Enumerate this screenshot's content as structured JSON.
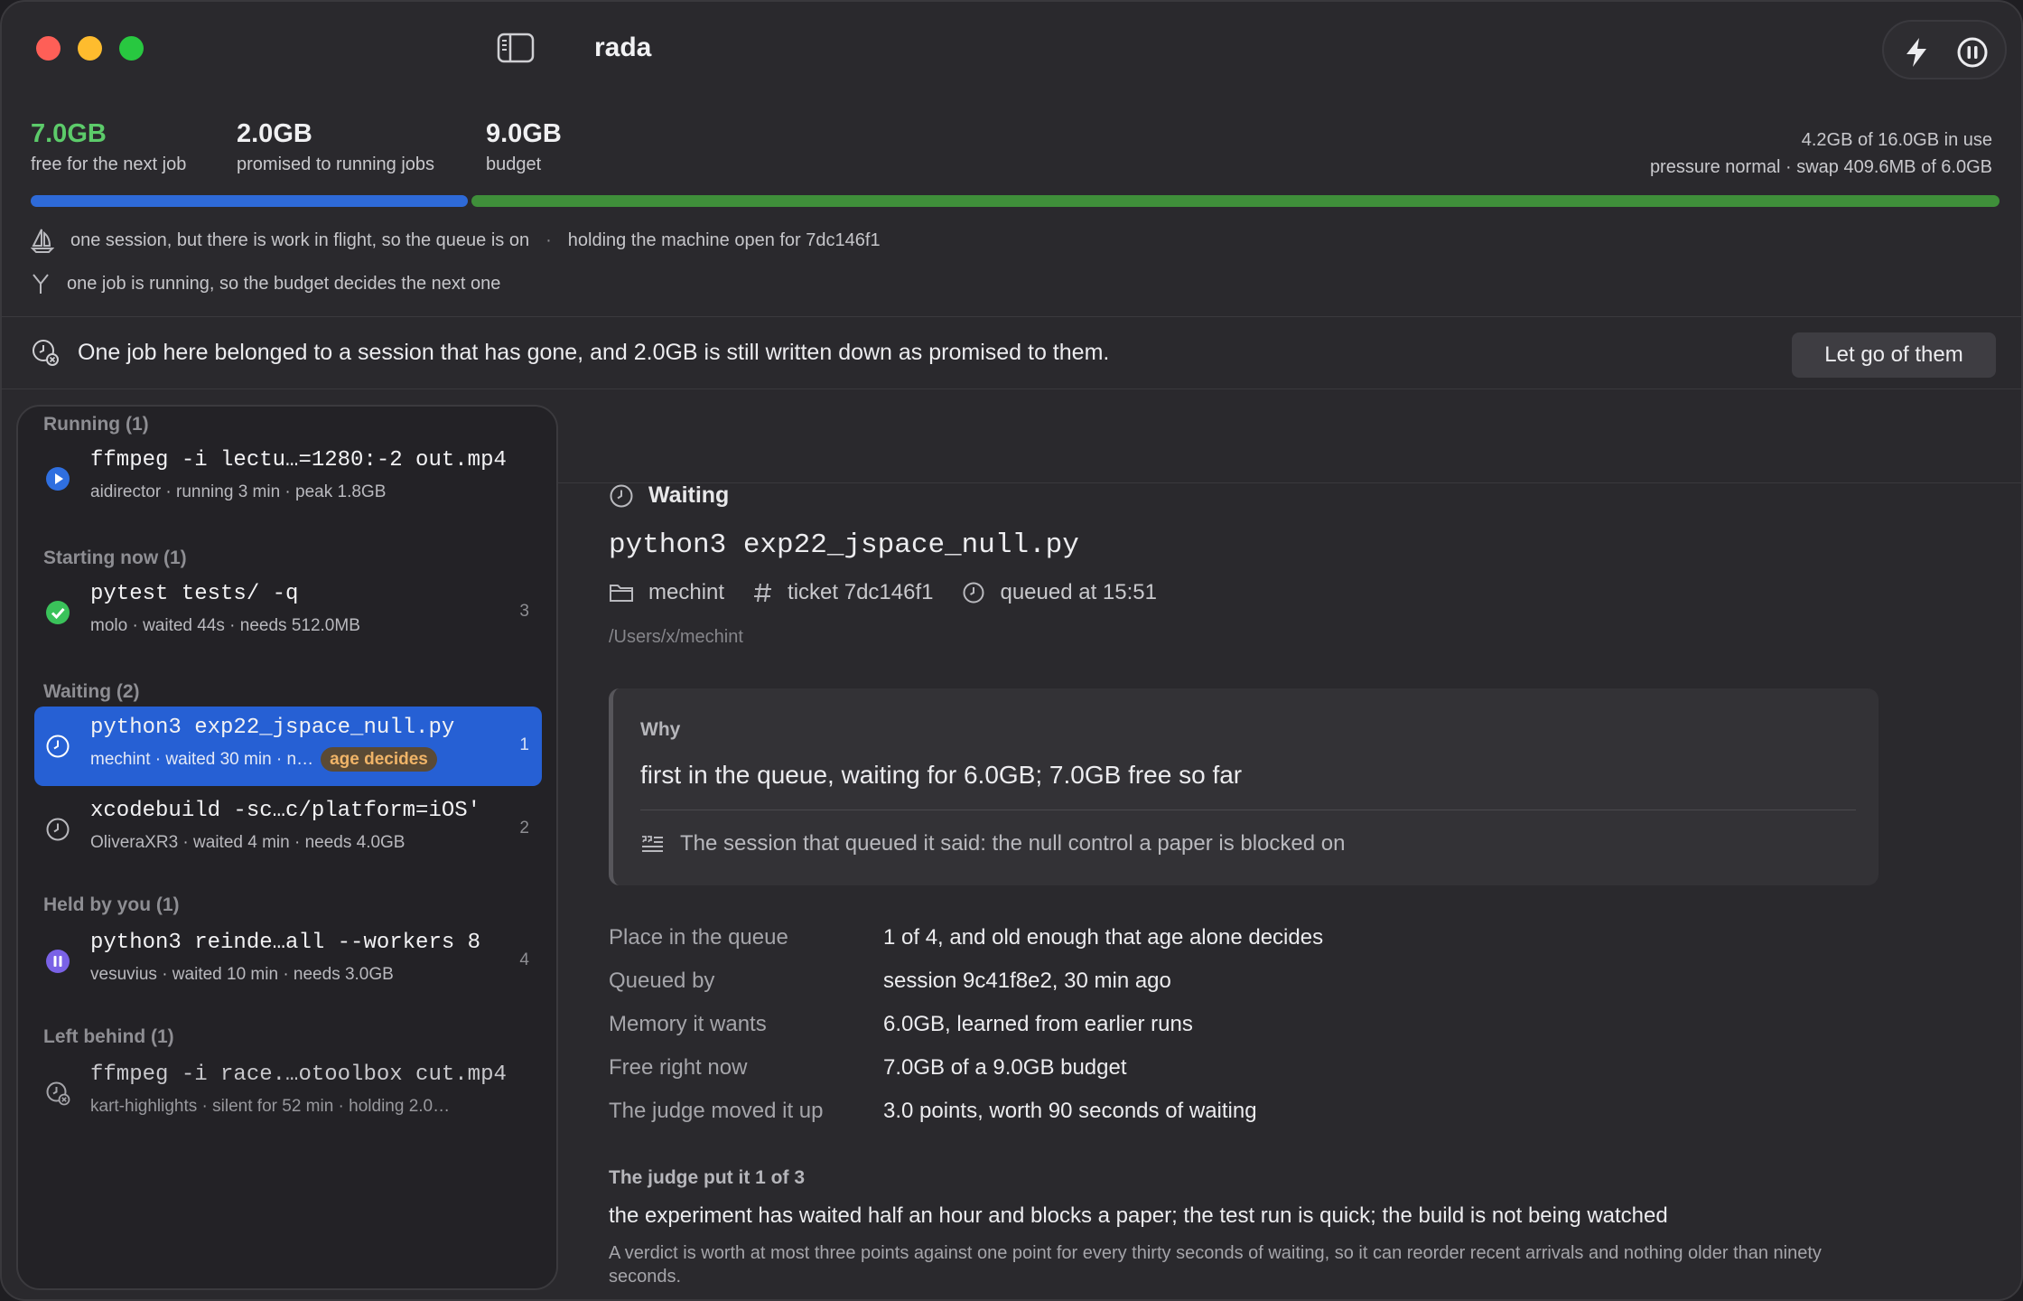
{
  "app": {
    "title": "rada"
  },
  "colors": {
    "accent_blue": "#2660d4",
    "free_green": "#5ccb6a",
    "bar_green": "#3f8f3a",
    "badge_orange": "#f0b468"
  },
  "toolbar": {
    "bolt_icon": "bolt-icon",
    "pause_icon": "pause-icon"
  },
  "stats": {
    "free": {
      "value": "7.0GB",
      "label": "free for the next job"
    },
    "promised": {
      "value": "2.0GB",
      "label": "promised to running jobs"
    },
    "budget": {
      "value": "9.0GB",
      "label": "budget"
    },
    "usage_line1": "4.2GB of 16.0GB in use",
    "usage_line2": "pressure normal · swap 409.6MB of 6.0GB"
  },
  "info": {
    "line1_a": "one session, but there is work in flight, so the queue is on",
    "line1_sep": "·",
    "line1_b": "holding the machine open for 7dc146f1",
    "line2": "one job is running, so the budget decides the next one"
  },
  "notice": {
    "text": "One job here belonged to a session that has gone, and 2.0GB is still written down as promised to them.",
    "button": "Let go of them"
  },
  "list": {
    "groups": [
      {
        "header": "Running (1)"
      },
      {
        "header": "Starting now (1)"
      },
      {
        "header": "Waiting (2)"
      },
      {
        "header": "Held by you (1)"
      },
      {
        "header": "Left behind (1)"
      }
    ],
    "items": [
      {
        "cmd": "ffmpeg -i lectu…=1280:-2 out.mp4",
        "meta": "aidirector  ·  running 3 min  ·  peak 1.8GB",
        "num": ""
      },
      {
        "cmd": "pytest tests/ -q",
        "meta": "molo  ·  waited 44s  ·  needs 512.0MB",
        "num": "3"
      },
      {
        "cmd": "python3 exp22_jspace_null.py",
        "meta": "mechint  ·  waited 30 min  ·  n…",
        "badge": "age decides",
        "num": "1"
      },
      {
        "cmd": "xcodebuild -sc…c/platform=iOS'",
        "meta": "OliveraXR3  ·  waited 4 min  ·  needs 4.0GB",
        "num": "2"
      },
      {
        "cmd": "python3 reinde…all --workers 8",
        "meta": "vesuvius  ·  waited 10 min  ·  needs 3.0GB",
        "num": "4"
      },
      {
        "cmd": "ffmpeg -i race.…otoolbox cut.mp4",
        "meta": "kart-highlights  ·  silent for 52 min  ·  holding 2.0…",
        "num": ""
      }
    ]
  },
  "detail": {
    "status": "Waiting",
    "cmd": "python3 exp22_jspace_null.py",
    "project": "mechint",
    "ticket": "ticket 7dc146f1",
    "queued": "queued at 15:51",
    "path": "/Users/x/mechint",
    "why": {
      "title": "Why",
      "text": "first in the queue, waiting for 6.0GB; 7.0GB free so far",
      "quote": "The session that queued it said: the null control a paper is blocked on"
    },
    "facts": [
      {
        "k": "Place in the queue",
        "v": "1 of 4, and old enough that age alone decides"
      },
      {
        "k": "Queued by",
        "v": "session 9c41f8e2, 30 min ago"
      },
      {
        "k": "Memory it wants",
        "v": "6.0GB, learned from earlier runs"
      },
      {
        "k": "Free right now",
        "v": "7.0GB of a 9.0GB budget"
      },
      {
        "k": "The judge moved it up",
        "v": "3.0 points, worth 90 seconds of waiting"
      }
    ],
    "judge": {
      "heading": "The judge put it 1 of 3",
      "text": "the experiment has waited half an hour and blocks a paper; the test run is quick; the build is not being watched",
      "note": "A verdict is worth at most three points against one point for every thirty seconds of waiting, so it can reorder recent arrivals and nothing older than ninety seconds."
    }
  }
}
